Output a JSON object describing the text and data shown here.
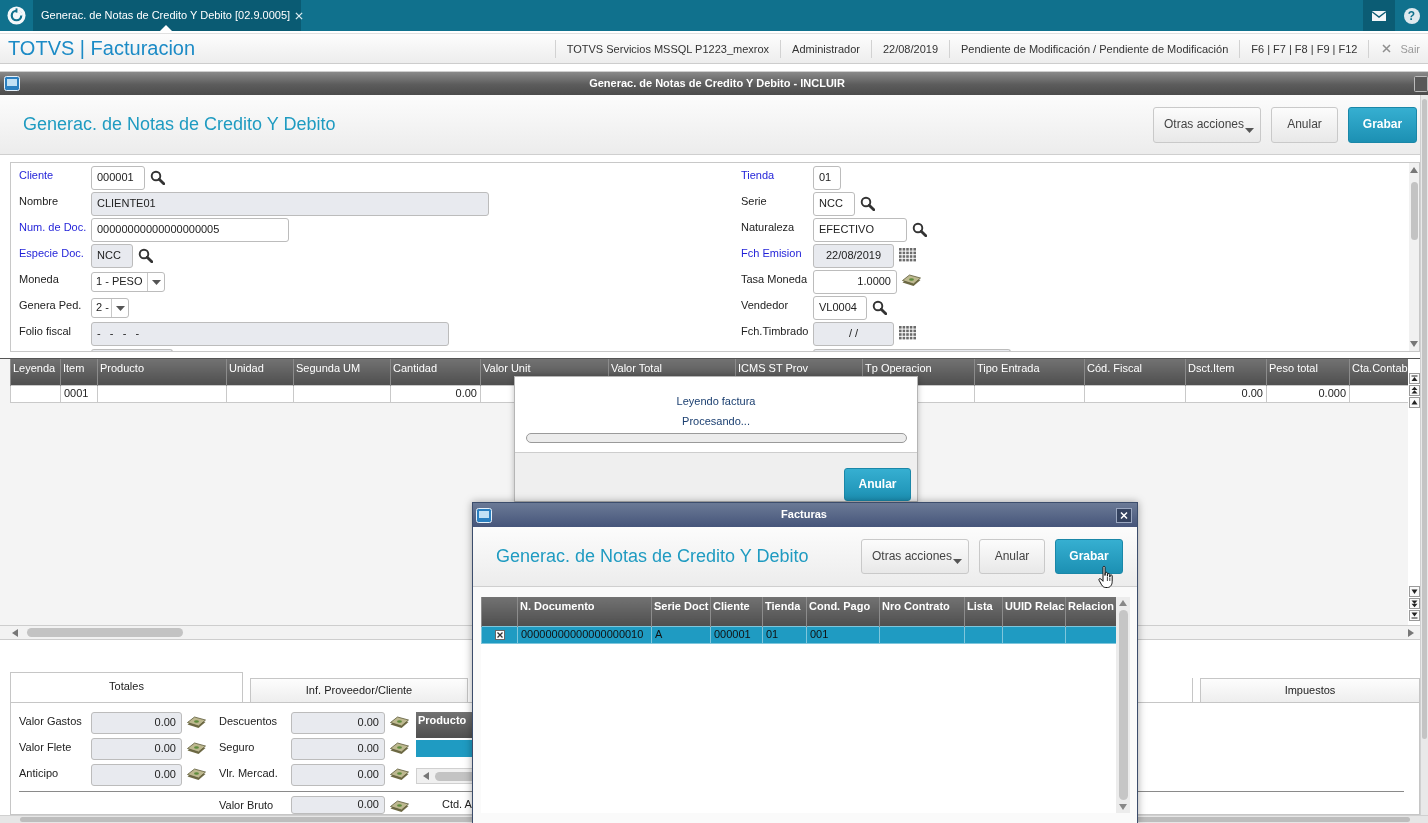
{
  "app_bar": {
    "tab": {
      "label": "Generac. de Notas de Credito Y Debito [02.9.0005]",
      "selected": true
    },
    "help": "?"
  },
  "header": {
    "product": "TOTVS | Facturacion",
    "info": [
      "TOTVS Servicios MSSQL P1223_mexrox",
      "Administrador",
      "22/08/2019",
      "Pendiente de Modificación / Pendiente de Modificación",
      "F6 | F7 | F8 | F9 | F12"
    ],
    "exit": "Sair"
  },
  "window": {
    "title": "Generac. de Notas de Credito Y Debito - INCLUIR"
  },
  "page": {
    "title": "Generac. de Notas de Credito Y Debito",
    "buttons": [
      {
        "label": "Otras acciones",
        "kind": "menu"
      },
      {
        "label": "Anular",
        "kind": "default"
      },
      {
        "label": "Grabar",
        "kind": "primary"
      }
    ]
  },
  "form": {
    "left": [
      {
        "label": "Cliente",
        "required": true,
        "kind": "lookup",
        "value": "000001",
        "readonly": false
      },
      {
        "label": "Nombre",
        "required": false,
        "kind": "text",
        "value": "CLIENTE01",
        "readonly": true
      },
      {
        "label": "Num. de Doc.",
        "required": true,
        "kind": "text",
        "value": "00000000000000000005",
        "readonly": false
      },
      {
        "label": "Especie Doc.",
        "required": true,
        "kind": "lookup",
        "value": "NCC",
        "readonly": true
      },
      {
        "label": "Moneda",
        "required": false,
        "kind": "select",
        "value": "1 - PESO",
        "readonly": false
      },
      {
        "label": "Genera Ped.",
        "required": false,
        "kind": "select",
        "value": "2 -",
        "readonly": false
      },
      {
        "label": "Folio fiscal",
        "required": false,
        "kind": "text",
        "value": "-   -   -   -",
        "readonly": true
      },
      {
        "kind": "text",
        "readonly": true
      }
    ],
    "right": [
      {
        "label": "Tienda",
        "required": true,
        "kind": "text",
        "value": "01",
        "readonly": false
      },
      {
        "label": "Serie",
        "required": false,
        "kind": "lookup",
        "value": "NCC",
        "readonly": false
      },
      {
        "label": "Naturaleza",
        "required": false,
        "kind": "lookup",
        "value": "EFECTIVO",
        "readonly": false
      },
      {
        "label": "Fch Emision",
        "required": true,
        "kind": "date",
        "value": "22/08/2019",
        "readonly": true
      },
      {
        "label": "Tasa Moneda",
        "required": false,
        "kind": "amount",
        "value": "1.0000",
        "readonly": false
      },
      {
        "label": "Vendedor",
        "required": false,
        "kind": "lookup",
        "value": "VL0004",
        "readonly": false
      },
      {
        "label": "Fch.Timbrado",
        "required": false,
        "kind": "date",
        "value": "/ /",
        "readonly": true
      },
      {
        "kind": "text",
        "readonly": true
      }
    ]
  },
  "items_grid": {
    "columns": [
      "Leyenda",
      "Item",
      "Producto",
      "Unidad",
      "Segunda UM",
      "Cantidad",
      "Valor Unit",
      "Valor Total",
      "ICMS ST Prov",
      "Tp Operacion",
      "Tipo Entrada",
      "Cód. Fiscal",
      "Dsct.Item",
      "Peso total",
      "Cta.Contab"
    ],
    "rows": [
      {
        "cells": [
          null,
          "0001",
          null,
          null,
          null,
          "0.00",
          null,
          null,
          null,
          null,
          null,
          null,
          "0.00",
          "0.000",
          null
        ]
      }
    ]
  },
  "bottom_tabs": [
    {
      "label": "Totales",
      "selected": true
    },
    {
      "label": "Inf. Proveedor/Cliente",
      "selected": false
    },
    {
      "label": "Impuestos",
      "selected": false
    }
  ],
  "totals": {
    "column_1": [
      {
        "label": "Valor Gastos",
        "value": "0.00",
        "readonly": true
      },
      {
        "label": "Valor Flete",
        "value": "0.00",
        "readonly": true
      },
      {
        "label": "Anticipo",
        "value": "0.00",
        "readonly": true
      }
    ],
    "column_2": [
      {
        "label": "Descuentos",
        "value": "0.00",
        "readonly": true
      },
      {
        "label": "Seguro",
        "value": "0.00",
        "readonly": true
      },
      {
        "label": "Vlr. Mercad.",
        "value": "0.00",
        "readonly": true
      }
    ],
    "products_grid": {
      "columns": [
        "Producto"
      ],
      "rows": [
        {
          "selected": true
        }
      ]
    },
    "summary": [
      {
        "label": "Valor Bruto",
        "value": "0.00",
        "readonly": true
      },
      {
        "label": "Ctd. A"
      }
    ]
  },
  "processing": {
    "title": "Leyendo factura",
    "message": "Procesando...",
    "progress": {
      "level": 0
    },
    "button": "Anular"
  },
  "facturas": {
    "title": "Facturas",
    "heading": "Generac. de Notas de Credito Y Debito",
    "buttons": [
      {
        "label": "Otras acciones",
        "kind": "menu"
      },
      {
        "label": "Anular",
        "kind": "default"
      },
      {
        "label": "Grabar",
        "kind": "primary"
      }
    ],
    "grid": {
      "columns": [
        "N. Documento",
        "Serie Doct",
        "Cliente",
        "Tienda",
        "Cond. Pago",
        "Nro Contrato",
        "Lista",
        "UUID Relac",
        "Relacion"
      ],
      "rows": [
        {
          "selected": true,
          "checked": true,
          "cells": [
            "00000000000000000010",
            "A",
            "000001",
            "01",
            "001",
            null,
            null,
            null,
            null
          ]
        }
      ]
    }
  }
}
